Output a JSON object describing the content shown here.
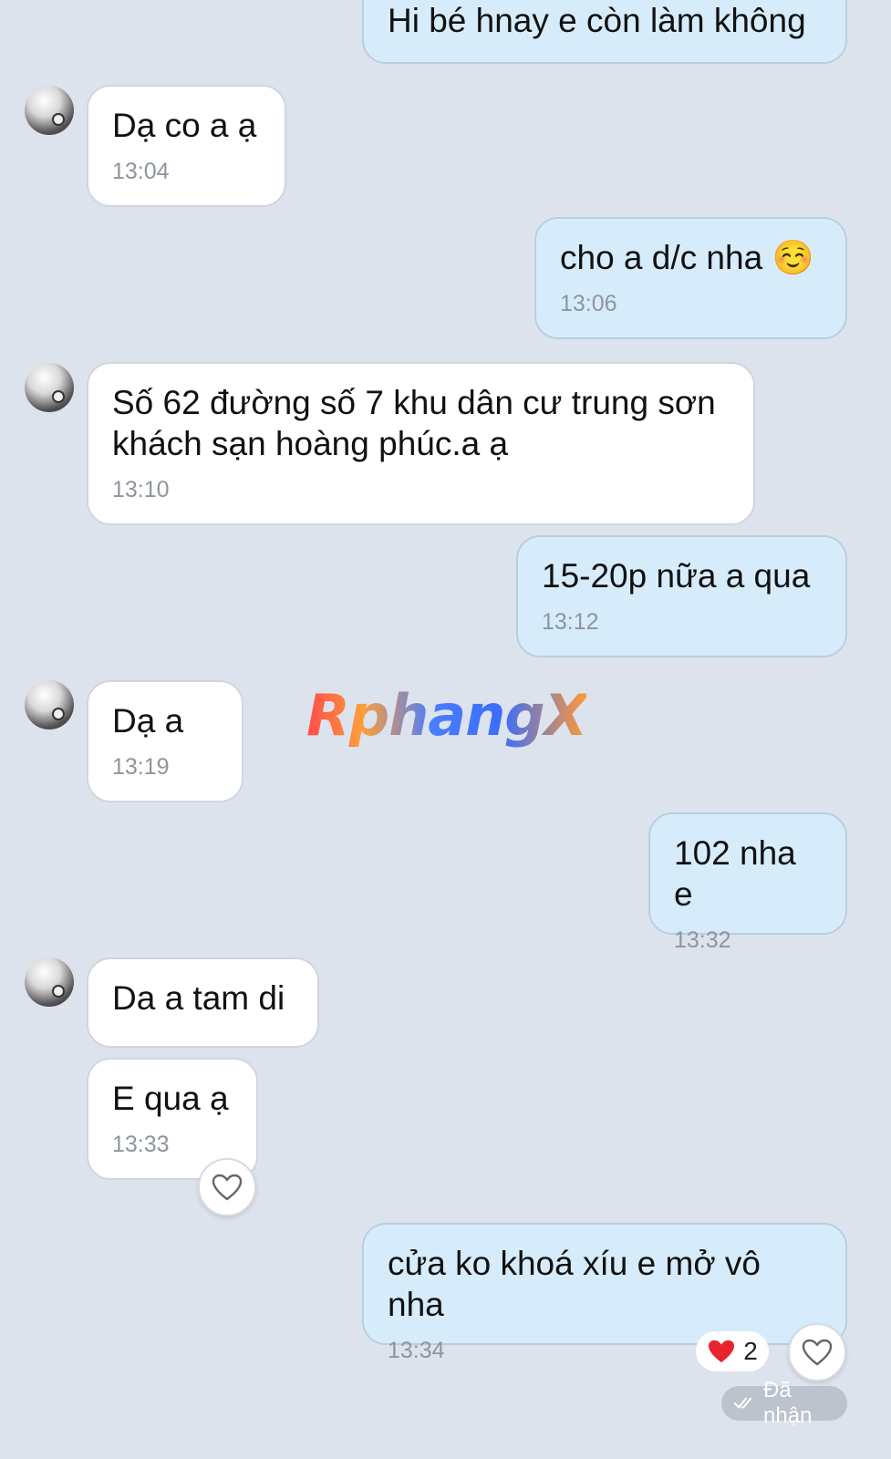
{
  "messages": [
    {
      "side": "out",
      "text": "Hi bé hnay e còn làm không",
      "time": ""
    },
    {
      "side": "in",
      "text": "Dạ co a ạ",
      "time": "13:04"
    },
    {
      "side": "out",
      "text": "cho a d/c nha ☺️",
      "time": "13:06"
    },
    {
      "side": "in",
      "text": "Số 62 đường số 7 khu dân cư trung sơn\nkhách sạn hoàng phúc.a ạ",
      "time": "13:10"
    },
    {
      "side": "out",
      "text": "15-20p nữa a qua",
      "time": "13:12"
    },
    {
      "side": "in",
      "text": "Dạ a",
      "time": "13:19"
    },
    {
      "side": "out",
      "text": "102 nha e",
      "time": "13:32"
    },
    {
      "side": "in",
      "text": "Da a tam di",
      "time": ""
    },
    {
      "side": "in",
      "text": "E qua ạ",
      "time": "13:33"
    },
    {
      "side": "out",
      "text": "cửa ko khoá xíu e mở vô nha",
      "time": "13:34"
    }
  ],
  "reaction": {
    "emoji": "❤️",
    "count": "2"
  },
  "status": {
    "label": "Đã nhận"
  },
  "watermark": "RphangX",
  "colors": {
    "background": "#dce3ec",
    "incoming": "#ffffff",
    "outgoing": "#d6ecfb"
  }
}
